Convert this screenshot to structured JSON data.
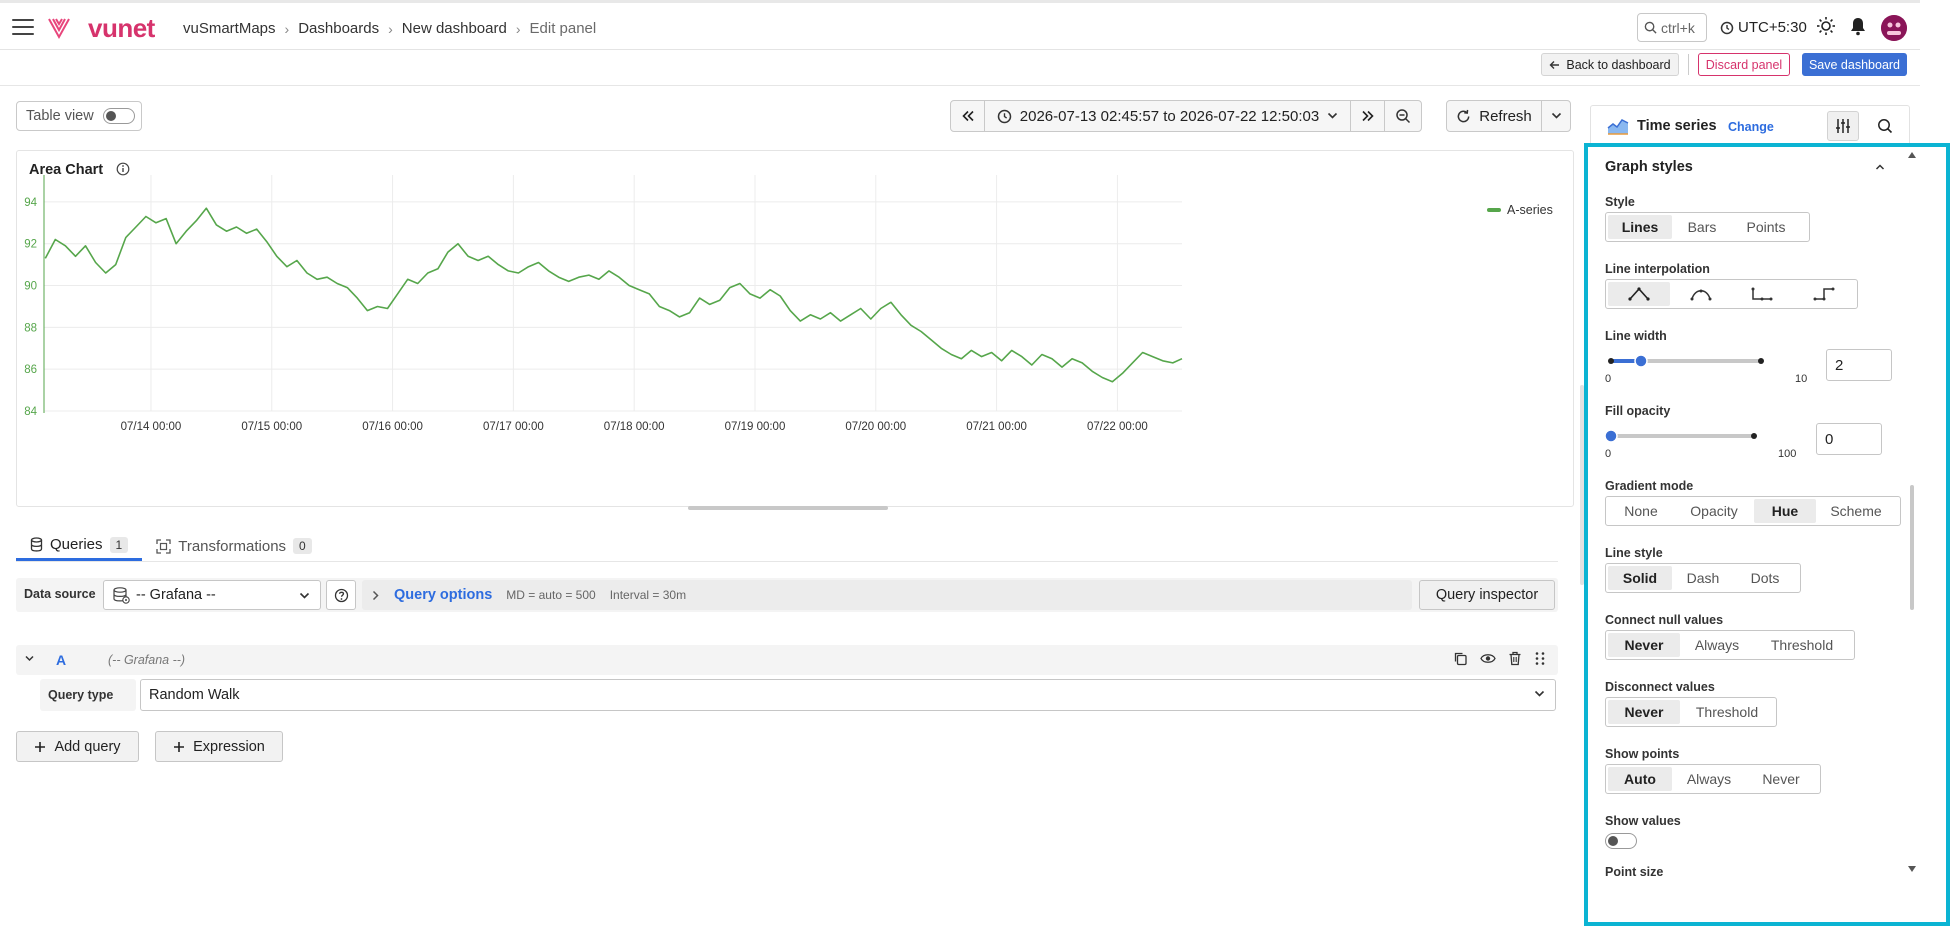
{
  "header": {
    "brand": "vunet",
    "breadcrumbs": [
      "vuSmartMaps",
      "Dashboards",
      "New dashboard",
      "Edit panel"
    ],
    "search_hint": "ctrl+k",
    "timezone": "UTC+5:30"
  },
  "actions": {
    "back": "Back to dashboard",
    "discard": "Discard panel",
    "save": "Save dashboard"
  },
  "controls": {
    "table_view": "Table view",
    "time_range": "2026-07-13 02:45:57 to 2026-07-22 12:50:03",
    "refresh": "Refresh"
  },
  "chart": {
    "title": "Area Chart",
    "legend": "A-series"
  },
  "chart_data": {
    "type": "line",
    "series": [
      {
        "name": "A-series",
        "color": "#56a64b"
      }
    ],
    "x_ticks": [
      "07/14 00:00",
      "07/15 00:00",
      "07/16 00:00",
      "07/17 00:00",
      "07/18 00:00",
      "07/19 00:00",
      "07/20 00:00",
      "07/21 00:00",
      "07/22 00:00"
    ],
    "y_ticks": [
      84,
      86,
      88,
      90,
      92,
      94
    ],
    "ylim": [
      84,
      95
    ],
    "x_start": "2026-07-13 02:45",
    "x_end": "2026-07-22 12:50",
    "grid": true,
    "legend_position": "top-right",
    "points": [
      [
        "07/13 03:00",
        91.3
      ],
      [
        "07/13 05:00",
        92.2
      ],
      [
        "07/13 07:00",
        91.9
      ],
      [
        "07/13 09:00",
        91.4
      ],
      [
        "07/13 11:00",
        91.9
      ],
      [
        "07/13 13:00",
        91.1
      ],
      [
        "07/13 15:00",
        90.6
      ],
      [
        "07/13 17:00",
        91.0
      ],
      [
        "07/13 19:00",
        92.3
      ],
      [
        "07/13 21:00",
        92.8
      ],
      [
        "07/13 23:00",
        93.3
      ],
      [
        "07/14 01:00",
        93.0
      ],
      [
        "07/14 03:00",
        93.2
      ],
      [
        "07/14 05:00",
        92.0
      ],
      [
        "07/14 07:00",
        92.6
      ],
      [
        "07/14 09:00",
        93.1
      ],
      [
        "07/14 11:00",
        93.7
      ],
      [
        "07/14 13:00",
        92.9
      ],
      [
        "07/14 15:00",
        92.6
      ],
      [
        "07/14 17:00",
        92.8
      ],
      [
        "07/14 19:00",
        92.5
      ],
      [
        "07/14 21:00",
        92.7
      ],
      [
        "07/14 23:00",
        92.1
      ],
      [
        "07/15 01:00",
        91.4
      ],
      [
        "07/15 03:00",
        90.9
      ],
      [
        "07/15 05:00",
        91.2
      ],
      [
        "07/15 07:00",
        90.6
      ],
      [
        "07/15 09:00",
        90.3
      ],
      [
        "07/15 11:00",
        90.4
      ],
      [
        "07/15 13:00",
        90.1
      ],
      [
        "07/15 15:00",
        89.9
      ],
      [
        "07/15 17:00",
        89.4
      ],
      [
        "07/15 19:00",
        88.8
      ],
      [
        "07/15 21:00",
        89.0
      ],
      [
        "07/15 23:00",
        88.9
      ],
      [
        "07/16 01:00",
        89.6
      ],
      [
        "07/16 03:00",
        90.3
      ],
      [
        "07/16 05:00",
        90.1
      ],
      [
        "07/16 07:00",
        90.6
      ],
      [
        "07/16 09:00",
        90.8
      ],
      [
        "07/16 11:00",
        91.6
      ],
      [
        "07/16 13:00",
        92.0
      ],
      [
        "07/16 15:00",
        91.4
      ],
      [
        "07/16 17:00",
        91.2
      ],
      [
        "07/16 19:00",
        91.4
      ],
      [
        "07/16 21:00",
        91.0
      ],
      [
        "07/16 23:00",
        90.7
      ],
      [
        "07/17 01:00",
        90.6
      ],
      [
        "07/17 03:00",
        90.9
      ],
      [
        "07/17 05:00",
        91.1
      ],
      [
        "07/17 07:00",
        90.7
      ],
      [
        "07/17 09:00",
        90.4
      ],
      [
        "07/17 11:00",
        90.2
      ],
      [
        "07/17 13:00",
        90.4
      ],
      [
        "07/17 15:00",
        90.5
      ],
      [
        "07/17 17:00",
        90.3
      ],
      [
        "07/17 19:00",
        90.7
      ],
      [
        "07/17 21:00",
        90.4
      ],
      [
        "07/17 23:00",
        90.0
      ],
      [
        "07/18 01:00",
        89.8
      ],
      [
        "07/18 03:00",
        89.6
      ],
      [
        "07/18 05:00",
        89.0
      ],
      [
        "07/18 07:00",
        88.8
      ],
      [
        "07/18 09:00",
        88.5
      ],
      [
        "07/18 11:00",
        88.7
      ],
      [
        "07/18 13:00",
        89.4
      ],
      [
        "07/18 15:00",
        89.1
      ],
      [
        "07/18 17:00",
        89.3
      ],
      [
        "07/18 19:00",
        89.9
      ],
      [
        "07/18 21:00",
        90.1
      ],
      [
        "07/18 23:00",
        89.6
      ],
      [
        "07/19 01:00",
        89.4
      ],
      [
        "07/19 03:00",
        89.8
      ],
      [
        "07/19 05:00",
        89.5
      ],
      [
        "07/19 07:00",
        88.8
      ],
      [
        "07/19 09:00",
        88.3
      ],
      [
        "07/19 11:00",
        88.6
      ],
      [
        "07/19 13:00",
        88.4
      ],
      [
        "07/19 15:00",
        88.7
      ],
      [
        "07/19 17:00",
        88.3
      ],
      [
        "07/19 19:00",
        88.6
      ],
      [
        "07/19 21:00",
        88.9
      ],
      [
        "07/19 23:00",
        88.4
      ],
      [
        "07/20 01:00",
        88.9
      ],
      [
        "07/20 03:00",
        89.2
      ],
      [
        "07/20 05:00",
        88.6
      ],
      [
        "07/20 07:00",
        88.1
      ],
      [
        "07/20 09:00",
        87.8
      ],
      [
        "07/20 11:00",
        87.4
      ],
      [
        "07/20 13:00",
        87.0
      ],
      [
        "07/20 15:00",
        86.7
      ],
      [
        "07/20 17:00",
        86.5
      ],
      [
        "07/20 19:00",
        86.9
      ],
      [
        "07/20 21:00",
        86.6
      ],
      [
        "07/20 23:00",
        86.8
      ],
      [
        "07/21 01:00",
        86.4
      ],
      [
        "07/21 03:00",
        86.9
      ],
      [
        "07/21 05:00",
        86.6
      ],
      [
        "07/21 07:00",
        86.2
      ],
      [
        "07/21 09:00",
        86.7
      ],
      [
        "07/21 11:00",
        86.5
      ],
      [
        "07/21 13:00",
        86.1
      ],
      [
        "07/21 15:00",
        86.5
      ],
      [
        "07/21 17:00",
        86.3
      ],
      [
        "07/21 19:00",
        85.9
      ],
      [
        "07/21 21:00",
        85.6
      ],
      [
        "07/21 23:00",
        85.4
      ],
      [
        "07/22 01:00",
        85.8
      ],
      [
        "07/22 03:00",
        86.3
      ],
      [
        "07/22 05:00",
        86.8
      ],
      [
        "07/22 07:00",
        86.6
      ],
      [
        "07/22 09:00",
        86.4
      ],
      [
        "07/22 11:00",
        86.3
      ],
      [
        "07/22 12:50",
        86.5
      ]
    ]
  },
  "queries": {
    "tab_queries": "Queries",
    "tab_queries_count": "1",
    "tab_transformations": "Transformations",
    "tab_transformations_count": "0",
    "data_source_label": "Data source",
    "data_source": "-- Grafana --",
    "query_options": "Query options",
    "md": "MD = auto = 500",
    "interval": "Interval = 30m",
    "inspector": "Query inspector",
    "query_letter": "A",
    "query_source": "(-- Grafana --)",
    "query_type_label": "Query type",
    "query_type": "Random Walk",
    "add_query": "Add query",
    "expression": "Expression"
  },
  "panel": {
    "viz_name": "Time series",
    "change": "Change",
    "section": "Graph styles",
    "style_label": "Style",
    "style_options": [
      "Lines",
      "Bars",
      "Points"
    ],
    "interp_label": "Line interpolation",
    "line_width_label": "Line width",
    "line_width_min": "0",
    "line_width_max": "10",
    "line_width_value": "2",
    "line_width_fraction": 0.2,
    "fill_opacity_label": "Fill opacity",
    "fill_min": "0",
    "fill_max": "100",
    "fill_value": "0",
    "fill_fraction": 0.0,
    "gradient_label": "Gradient mode",
    "gradient_options": [
      "None",
      "Opacity",
      "Hue",
      "Scheme"
    ],
    "line_style_label": "Line style",
    "line_style_options": [
      "Solid",
      "Dash",
      "Dots"
    ],
    "connect_label": "Connect null values",
    "connect_options": [
      "Never",
      "Always",
      "Threshold"
    ],
    "disconnect_label": "Disconnect values",
    "disconnect_options": [
      "Never",
      "Threshold"
    ],
    "show_points_label": "Show points",
    "show_points_options": [
      "Auto",
      "Always",
      "Never"
    ],
    "show_values_label": "Show values",
    "point_size_label": "Point size"
  }
}
